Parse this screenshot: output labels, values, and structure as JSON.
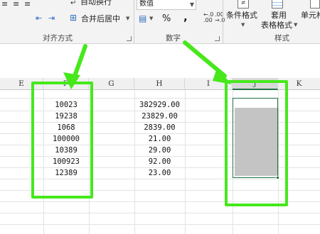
{
  "ribbon": {
    "wrap_text": "自动换行",
    "merge_center": "合并后居中",
    "alignment_group": "对齐方式",
    "number_format_value": "数值",
    "percent_symbol": "%",
    "comma_symbol": ",",
    "number_group": "数字",
    "conditional_formatting": "条件格式",
    "format_as_table_line1": "套用",
    "format_as_table_line2": "表格格式",
    "cell_styles": "单元格",
    "styles_group": "样式"
  },
  "sheet": {
    "columns": [
      "E",
      "F",
      "G",
      "H",
      "I",
      "J",
      "K"
    ],
    "selected_column": "J",
    "col_f_values": [
      "10023",
      "19238",
      "1068",
      "100000",
      "10389",
      "100923",
      "12389"
    ],
    "col_h_values": [
      "382929.00",
      "23829.00",
      "2839.00",
      "21.00",
      "29.00",
      "92.00",
      "23.00"
    ]
  },
  "colors": {
    "annotation_green": "#46e81c",
    "excel_green": "#217346",
    "selection_gray": "#c4c4c4"
  }
}
